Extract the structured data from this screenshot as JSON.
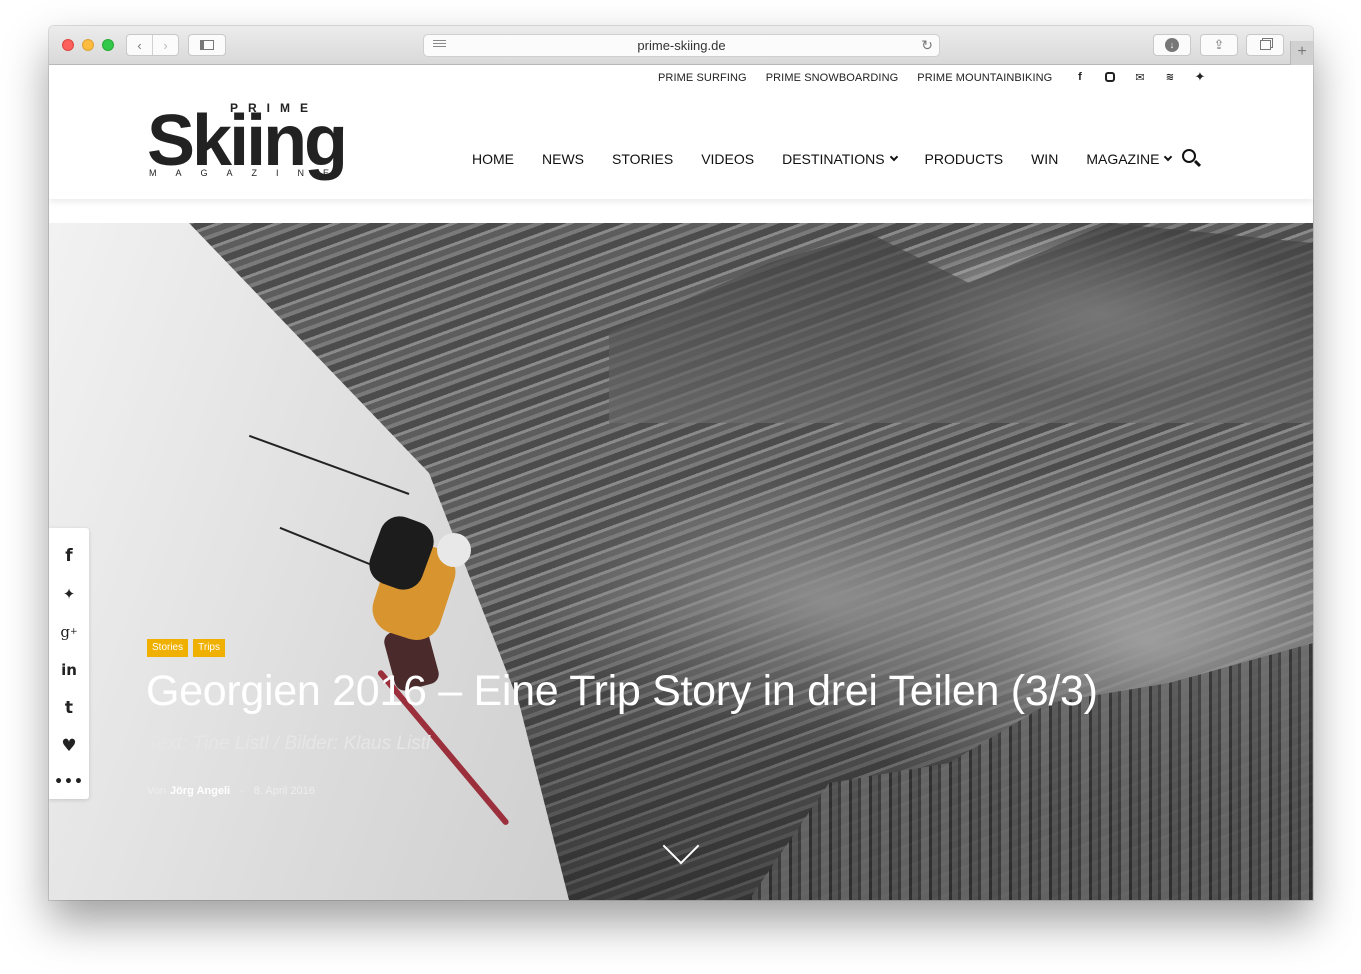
{
  "browser": {
    "url": "prime-skiing.de"
  },
  "site": {
    "logo_top": "PRIME",
    "logo_word": "Skiing",
    "logo_bottom": "MAGAZINE"
  },
  "top_nav": [
    "PRIME SURFING",
    "PRIME SNOWBOARDING",
    "PRIME MOUNTAINBIKING"
  ],
  "top_social": [
    "facebook-icon",
    "instagram-icon",
    "mail-icon",
    "rss-icon",
    "twitter-icon"
  ],
  "main_nav": [
    {
      "label": "HOME"
    },
    {
      "label": "NEWS"
    },
    {
      "label": "STORIES"
    },
    {
      "label": "VIDEOS"
    },
    {
      "label": "DESTINATIONS",
      "dropdown": true
    },
    {
      "label": "PRODUCTS"
    },
    {
      "label": "WIN"
    },
    {
      "label": "MAGAZINE",
      "dropdown": true
    }
  ],
  "share_rail": [
    "facebook-icon",
    "twitter-icon",
    "google-plus-icon",
    "linkedin-icon",
    "tumblr-icon",
    "heart-icon",
    "more-icon"
  ],
  "article": {
    "tags": [
      "Stories",
      "Trips"
    ],
    "title": "Georgien 2016 – Eine Trip Story in drei Teilen (3/3)",
    "subtitle": "Text: Tine Listl / Bilder: Klaus Listl",
    "by_prefix": "Von",
    "author": "Jörg Angeli",
    "separator": "-",
    "date": "8. April 2016"
  },
  "colors": {
    "tag_bg": "#f0b000",
    "accent": "#222222"
  }
}
